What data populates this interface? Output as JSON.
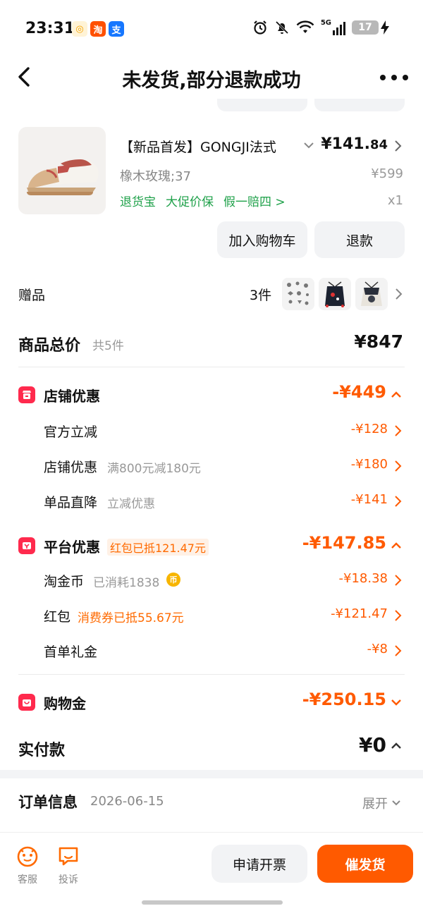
{
  "status_bar": {
    "time": "23:31",
    "app_icons": [
      {
        "name": "album-app-icon",
        "glyph": "◎",
        "color": "#f6a300"
      },
      {
        "name": "taobao-app-icon",
        "glyph": "淘",
        "color": "#ff5000"
      },
      {
        "name": "alipay-app-icon",
        "glyph": "支",
        "color": "#1677ff"
      }
    ],
    "network": "5G",
    "battery": "17"
  },
  "nav": {
    "title": "未发货,部分退款成功"
  },
  "product": {
    "title": "【新品首发】GONGJI法式",
    "price_main": "¥141.",
    "price_decimal": "84",
    "spec": "橡木玫瑰;37",
    "original_price": "¥599",
    "tags": [
      "退货宝",
      "大促价保",
      "假一赔四 >"
    ],
    "quantity": "x1",
    "add_cart_label": "加入购物车",
    "refund_label": "退款"
  },
  "gift": {
    "label": "赠品",
    "count": "3件"
  },
  "total": {
    "label": "商品总价",
    "count": "共5件",
    "value": "¥847"
  },
  "store_discount": {
    "title": "店铺优惠",
    "amount": "-¥449",
    "items": [
      {
        "label": "官方立减",
        "note": "",
        "amount": "-¥128"
      },
      {
        "label": "店铺优惠",
        "note": "满800元减180元",
        "amount": "-¥180"
      },
      {
        "label": "单品直降",
        "note": "立减优惠",
        "amount": "-¥141"
      }
    ]
  },
  "platform_discount": {
    "title": "平台优惠",
    "note": "红包已抵121.47元",
    "amount": "-¥147.85",
    "items": [
      {
        "label": "淘金币",
        "note": "已消耗1838",
        "amount": "-¥18.38"
      },
      {
        "label": "红包",
        "note": "消费券已抵55.67元",
        "amount": "-¥121.47"
      },
      {
        "label": "首单礼金",
        "note": "",
        "amount": "-¥8"
      }
    ]
  },
  "shopping_credit": {
    "title": "购物金",
    "amount": "-¥250.15"
  },
  "paid": {
    "label": "实付款",
    "value": "¥0"
  },
  "order_info": {
    "label": "订单信息",
    "date": "2026-06-15",
    "expand": "展开"
  },
  "bottom": {
    "service_label": "客服",
    "complain_label": "投诉",
    "invoice_label": "申请开票",
    "urge_label": "催发货"
  },
  "colors": {
    "accent": "#ff5a00",
    "badge_red": "#ff2a4d",
    "green": "#1fa14a"
  }
}
